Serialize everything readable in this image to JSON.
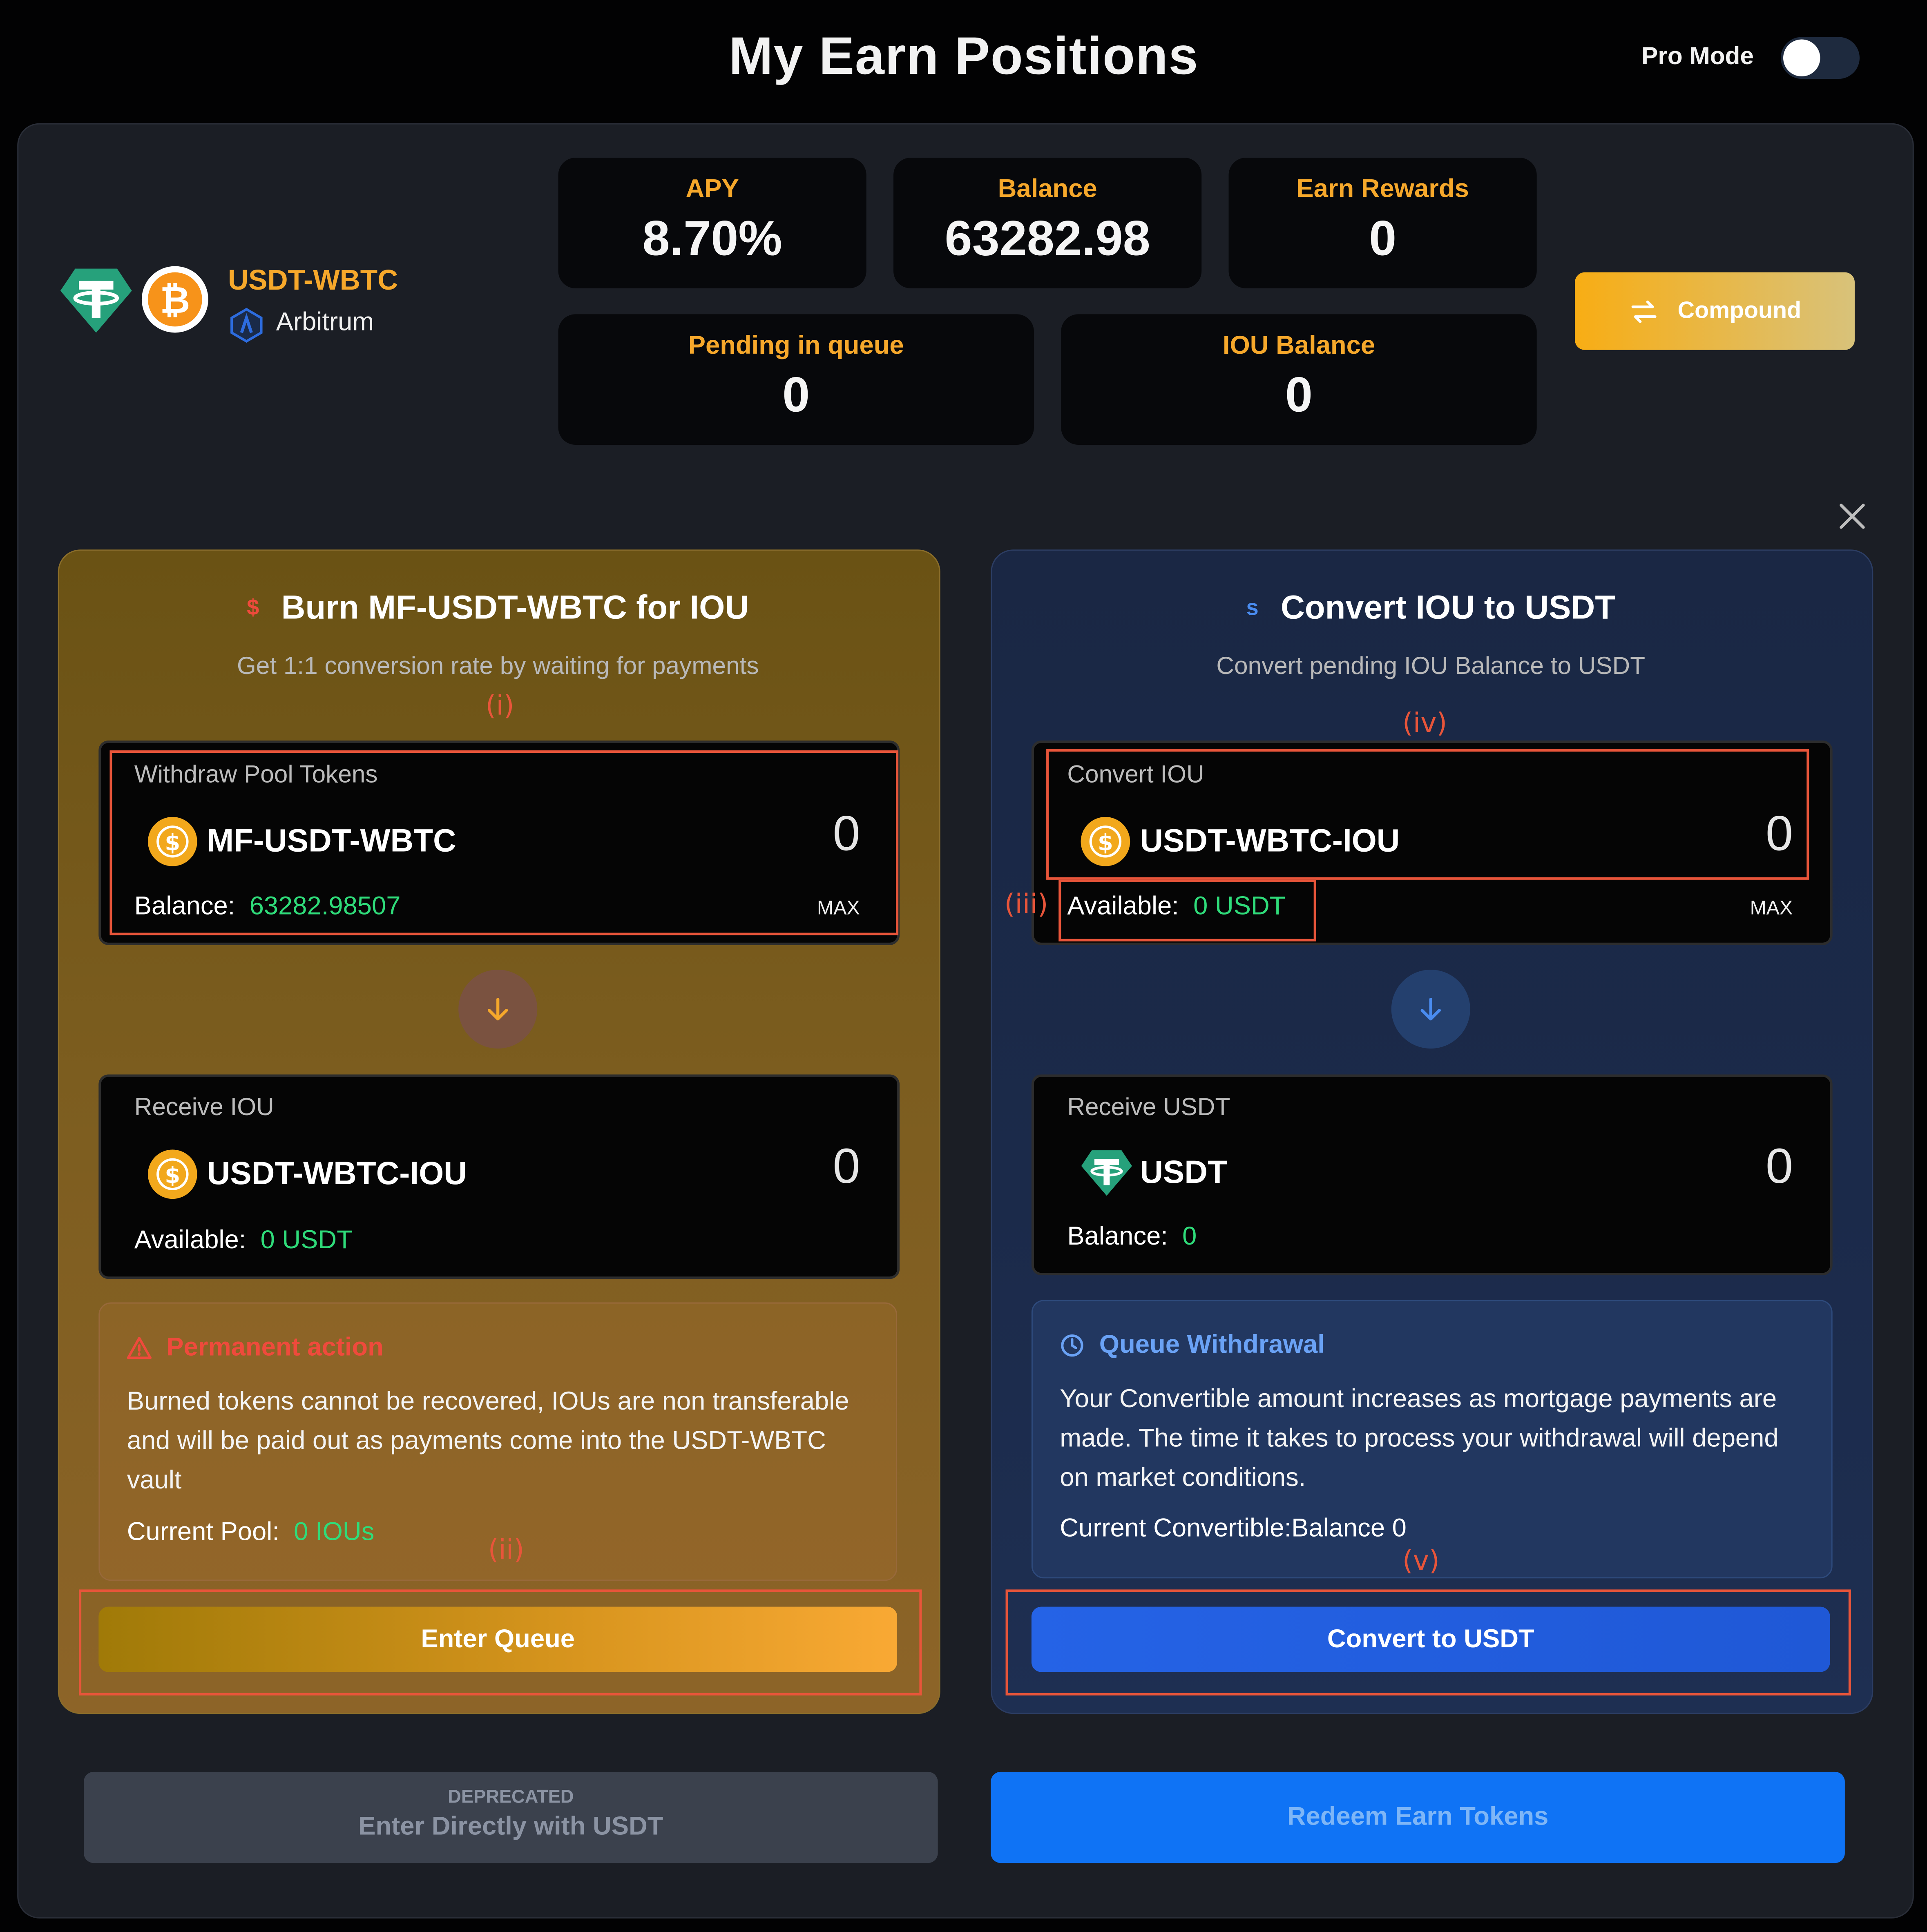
{
  "page": {
    "title": "My Earn Positions",
    "pro_mode_label": "Pro Mode",
    "pro_mode_enabled": false
  },
  "pool": {
    "pair": "USDT-WBTC",
    "chain": "Arbitrum"
  },
  "stats": {
    "apy": {
      "label": "APY",
      "value": "8.70%"
    },
    "balance": {
      "label": "Balance",
      "value": "63282.98"
    },
    "earn_rewards": {
      "label": "Earn Rewards",
      "value": "0"
    },
    "pending": {
      "label": "Pending in queue",
      "value": "0"
    },
    "iou_balance": {
      "label": "IOU Balance",
      "value": "0"
    }
  },
  "compound_button": "Compound",
  "burn_card": {
    "icon_glyph": "$",
    "title": "Burn MF-USDT-WBTC for IOU",
    "subtitle": "Get 1:1 conversion rate by waiting for payments",
    "withdraw": {
      "label": "Withdraw Pool Tokens",
      "token": "MF-USDT-WBTC",
      "amount": "0",
      "balance_label": "Balance:",
      "balance_value": "63282.98507",
      "max": "MAX"
    },
    "receive": {
      "label": "Receive IOU",
      "token": "USDT-WBTC-IOU",
      "amount": "0",
      "available_label": "Available:",
      "available_value": "0 USDT"
    },
    "notice": {
      "title": "Permanent action",
      "body": "Burned tokens cannot be recovered, IOUs are non transferable and will be paid out as payments come into the USDT-WBTC vault",
      "pool_label": "Current Pool:",
      "pool_value": "0 IOUs"
    },
    "button": "Enter Queue"
  },
  "convert_card": {
    "icon_glyph": "s",
    "title": "Convert IOU to USDT",
    "subtitle": "Convert pending IOU Balance to USDT",
    "convert": {
      "label": "Convert IOU",
      "token": "USDT-WBTC-IOU",
      "amount": "0",
      "available_label": "Available:",
      "available_value": "0 USDT",
      "max": "MAX"
    },
    "receive": {
      "label": "Receive USDT",
      "token": "USDT",
      "amount": "0",
      "balance_label": "Balance:",
      "balance_value": "0"
    },
    "notice": {
      "title": "Queue Withdrawal",
      "body": "Your Convertible amount increases as mortgage payments are made. The time it takes to process your withdrawal will depend on market conditions.",
      "current": "Current Convertible:Balance 0"
    },
    "button": "Convert to USDT"
  },
  "annotations": {
    "i": "(i)",
    "ii": "(ii)",
    "iii": "(iii)",
    "iv": "(iv)",
    "v": "(v)"
  },
  "bottom": {
    "deprecated_label": "DEPRECATED",
    "enter_direct": "Enter Directly with USDT",
    "redeem": "Redeem Earn Tokens"
  },
  "colors": {
    "accent_orange": "#f6a82b",
    "green": "#2fdc7a",
    "blue_button": "#2160e0",
    "annotation_red": "#e8553a"
  },
  "icons": [
    "tether-icon",
    "bitcoin-icon",
    "arbitrum-icon",
    "swap-icon",
    "close-icon",
    "arrow-down-icon",
    "warning-icon",
    "clock-icon",
    "synth-coin-icon"
  ]
}
